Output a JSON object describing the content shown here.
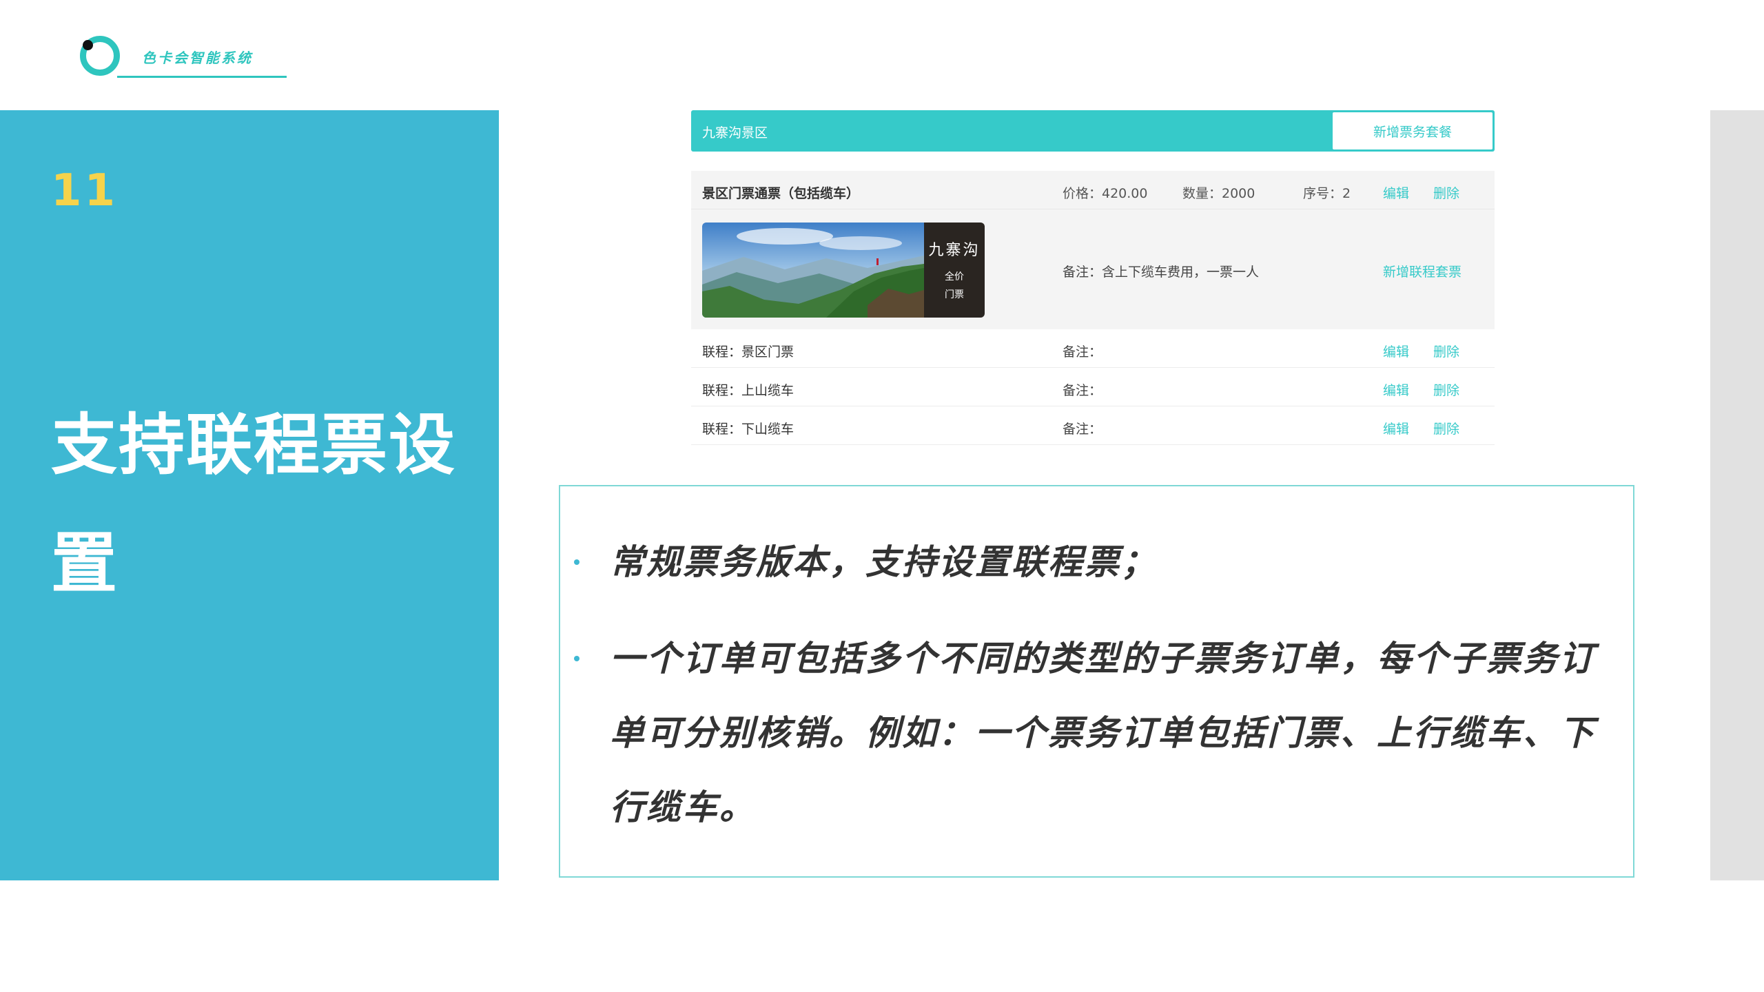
{
  "logo": {
    "text": "色卡会智能系统",
    "icon": "ring-logo-icon"
  },
  "left_panel": {
    "number": "11",
    "title": "支持联程票设置"
  },
  "screenshot": {
    "header_title": "九寨沟景区",
    "add_package_button": "新增票务套餐",
    "ticket": {
      "name": "景区门票通票（包括缆车）",
      "price": "价格：420.00",
      "quantity": "数量：2000",
      "sequence": "序号：2",
      "edit": "编辑",
      "delete": "删除",
      "image_title": "九寨沟",
      "image_line2": "全价",
      "image_line3": "门票",
      "note": "备注：含上下缆车费用，一票一人",
      "add_link": "新增联程套票"
    },
    "sub_tickets": [
      {
        "name": "联程：景区门票",
        "note": "备注：",
        "edit": "编辑",
        "delete": "删除"
      },
      {
        "name": "联程：上山缆车",
        "note": "备注：",
        "edit": "编辑",
        "delete": "删除"
      },
      {
        "name": "联程：下山缆车",
        "note": "备注：",
        "edit": "编辑",
        "delete": "删除"
      }
    ]
  },
  "bullets": [
    "常规票务版本，支持设置联程票；",
    "一个订单可包括多个不同的类型的子票务订单，每个子票务订单可分别核销。例如：一个票务订单包括门票、上行缆车、下行缆车。"
  ],
  "colors": {
    "panel": "#3eb8d3",
    "accent": "#36cac9",
    "number": "#f6d34b"
  }
}
